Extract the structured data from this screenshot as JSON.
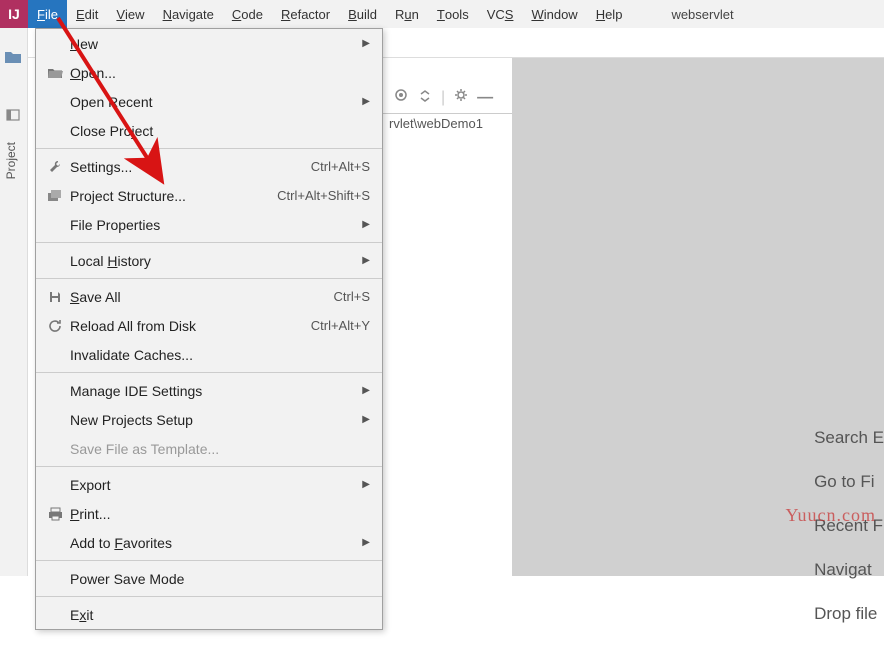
{
  "menubar": {
    "items": [
      "File",
      "Edit",
      "View",
      "Navigate",
      "Code",
      "Refactor",
      "Build",
      "Run",
      "Tools",
      "VCS",
      "Window",
      "Help"
    ],
    "underlines": [
      "F",
      "E",
      "V",
      "N",
      "C",
      "R",
      "B",
      "u",
      "T",
      "S",
      "W",
      "H"
    ],
    "active_index": 0
  },
  "project_name": "webservlet",
  "left_gutter": {
    "tab_label": "Project"
  },
  "dropdown": {
    "groups": [
      [
        {
          "icon": "",
          "label": "New",
          "u": "N",
          "shortcut": "",
          "submenu": true
        },
        {
          "icon": "folder-open",
          "label": "Open...",
          "u": "O",
          "shortcut": "",
          "submenu": false
        },
        {
          "icon": "",
          "label": "Open Recent",
          "u": "",
          "shortcut": "",
          "submenu": true
        },
        {
          "icon": "",
          "label": "Close Project",
          "u": "",
          "shortcut": "",
          "submenu": false
        }
      ],
      [
        {
          "icon": "wrench",
          "label": "Settings...",
          "u": "T",
          "shortcut": "Ctrl+Alt+S",
          "submenu": false
        },
        {
          "icon": "folders",
          "label": "Project Structure...",
          "u": "",
          "shortcut": "Ctrl+Alt+Shift+S",
          "submenu": false
        },
        {
          "icon": "",
          "label": "File Properties",
          "u": "",
          "shortcut": "",
          "submenu": true
        }
      ],
      [
        {
          "icon": "",
          "label": "Local History",
          "u": "H",
          "shortcut": "",
          "submenu": true
        }
      ],
      [
        {
          "icon": "save",
          "label": "Save All",
          "u": "S",
          "shortcut": "Ctrl+S",
          "submenu": false
        },
        {
          "icon": "reload",
          "label": "Reload All from Disk",
          "u": "",
          "shortcut": "Ctrl+Alt+Y",
          "submenu": false
        },
        {
          "icon": "",
          "label": "Invalidate Caches...",
          "u": "",
          "shortcut": "",
          "submenu": false
        }
      ],
      [
        {
          "icon": "",
          "label": "Manage IDE Settings",
          "u": "",
          "shortcut": "",
          "submenu": true
        },
        {
          "icon": "",
          "label": "New Projects Setup",
          "u": "",
          "shortcut": "",
          "submenu": true
        },
        {
          "icon": "",
          "label": "Save File as Template...",
          "u": "",
          "shortcut": "",
          "submenu": false,
          "disabled": true
        }
      ],
      [
        {
          "icon": "",
          "label": "Export",
          "u": "",
          "shortcut": "",
          "submenu": true
        },
        {
          "icon": "print",
          "label": "Print...",
          "u": "P",
          "shortcut": "",
          "submenu": false
        },
        {
          "icon": "",
          "label": "Add to Favorites",
          "u": "F",
          "shortcut": "",
          "submenu": true
        }
      ],
      [
        {
          "icon": "",
          "label": "Power Save Mode",
          "u": "",
          "shortcut": "",
          "submenu": false
        }
      ],
      [
        {
          "icon": "",
          "label": "Exit",
          "u": "x",
          "shortcut": "",
          "submenu": false
        }
      ]
    ]
  },
  "right_toolbar": {
    "path": "rvlet\\webDemo1"
  },
  "hints": [
    "Search E",
    "Go to Fi",
    "Recent F",
    "Navigat",
    "Drop file"
  ],
  "watermark": "Yuucn.com"
}
